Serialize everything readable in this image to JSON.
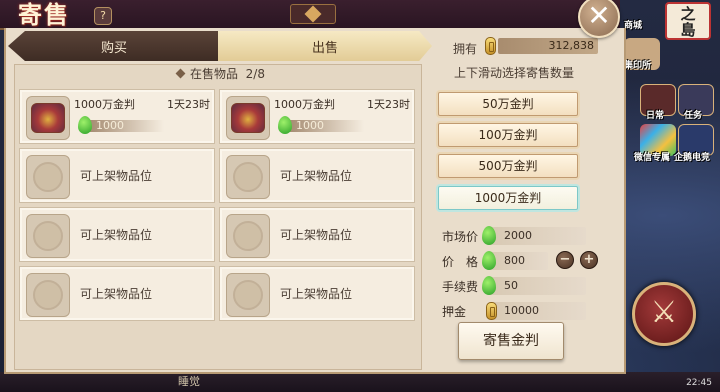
{
  "header": {
    "title": "寄售",
    "help": "?",
    "close": "✕"
  },
  "tabs": {
    "buy": "购买",
    "sell": "出售"
  },
  "owned": {
    "label": "拥有",
    "value": "312,838"
  },
  "listing": {
    "header": "在售物品",
    "count": "2/8",
    "items": [
      {
        "name": "1000万金判",
        "time": "1天23时",
        "price": "1000"
      },
      {
        "name": "1000万金判",
        "time": "1天23时",
        "price": "1000"
      }
    ],
    "empty_label": "可上架物品位"
  },
  "sell_panel": {
    "header": "上下滑动选择寄售数量",
    "options": [
      "50万金判",
      "100万金判",
      "500万金判",
      "1000万金判"
    ],
    "selected_index": 3,
    "market_label": "市场价",
    "market_value": "2000",
    "price_label": "价　格",
    "price_value": "800",
    "fee_label": "手续费",
    "fee_value": "50",
    "deposit_label": "押金",
    "deposit_value": "10000",
    "minus": "−",
    "plus": "+",
    "sell_button": "寄售金判"
  },
  "side": {
    "island": [
      "之",
      "島"
    ],
    "shop": "商城",
    "seal": "集印所",
    "daily": "日常",
    "task": "任务",
    "wechat": "微信专属",
    "penguin": "企鹅电竞"
  },
  "bottom": {
    "text": "睡觉",
    "clock": "22:45"
  }
}
